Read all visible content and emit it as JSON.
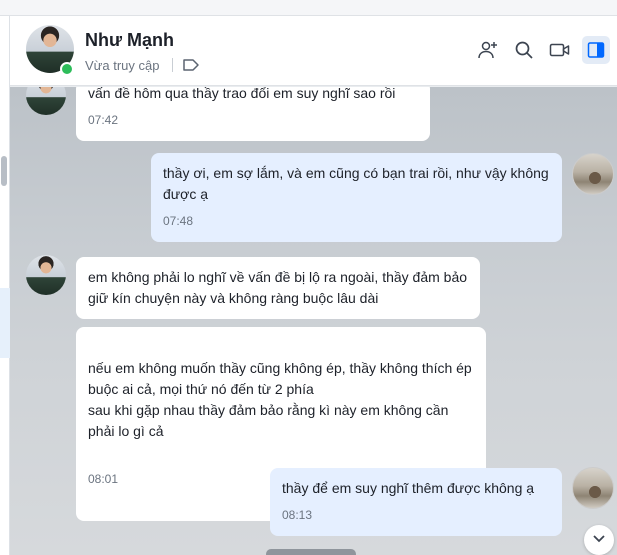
{
  "contact": {
    "name": "Như Mạnh",
    "status": "Vừa truy cập"
  },
  "header_icons": [
    "add-member-icon",
    "search-icon",
    "video-call-icon",
    "sidebar-toggle-icon"
  ],
  "colors": {
    "outgoing_bubble": "#e5efff",
    "incoming_bubble": "#ffffff",
    "online": "#2dbd5a",
    "accent": "#0068ff"
  },
  "messages": [
    {
      "direction": "in",
      "text": "vấn đề hôm qua thầy trao đổi em suy nghĩ sao rồi",
      "time": "07:42"
    },
    {
      "direction": "out",
      "text": "thầy ơi, em sợ lắm, và em cũng có  bạn trai rồi, như vậy không được ạ",
      "time": "07:48"
    },
    {
      "direction": "in",
      "text": "em không phải lo nghĩ về vấn đề bị lộ ra ngoài, thầy đảm bảo giữ kín chuyện này và không ràng buộc lâu dài",
      "time": ""
    },
    {
      "direction": "in",
      "text": "nếu em không muốn thầy cũng không ép, thầy không thích ép buộc ai cả, mọi thứ nó đến từ 2 phía\nsau khi gặp nhau thầy đảm bảo rằng kì này em không cần phải lo  gì cả",
      "time": "08:01"
    },
    {
      "direction": "out",
      "text": "thầy để em suy nghĩ thêm được không ạ",
      "time": "08:13"
    }
  ]
}
